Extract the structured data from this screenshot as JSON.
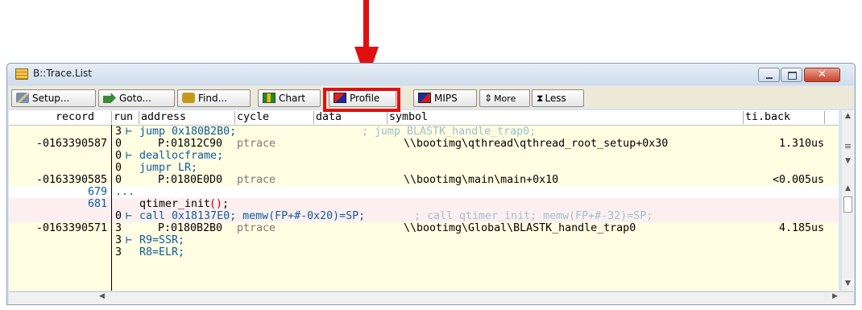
{
  "window": {
    "title": "B::Trace.List"
  },
  "toolbar": {
    "setup": "Setup...",
    "goto": "Goto...",
    "find": "Find...",
    "chart": "Chart",
    "profile": "Profile",
    "mips": "MIPS",
    "more": "More",
    "less": "Less"
  },
  "columns": {
    "record": "record",
    "run": "run",
    "address": "address",
    "cycle": "cycle",
    "data": "data",
    "symbol": "symbol",
    "tiback": "ti.back"
  },
  "rows": [
    {
      "bg": "y",
      "record": "",
      "run": "3",
      "text": "jump 0x180B2B0;",
      "comment": "; jump BLASTK_handle_trap0;"
    },
    {
      "bg": "y",
      "record": "-0163390587",
      "run": "0",
      "address": "P:01812C90",
      "cycle": "ptrace",
      "symbol": "\\\\bootimg\\qthread\\qthread_root_setup+0x30",
      "tiback": "1.310us"
    },
    {
      "bg": "y",
      "record": "",
      "run": "0",
      "text": "deallocframe;"
    },
    {
      "bg": "y",
      "record": "",
      "run": "0",
      "text": "jumpr LR;"
    },
    {
      "bg": "y",
      "record": "-0163390585",
      "run": "0",
      "address": "P:0180E0D0",
      "cycle": "ptrace",
      "symbol": "\\\\bootimg\\main\\main+0x10",
      "tiback": "<0.005us"
    },
    {
      "bg": "w",
      "record": "679",
      "run": "...",
      "text": ""
    },
    {
      "bg": "p",
      "record": "681",
      "run": "",
      "source": "qtimer_init",
      "paren": "()",
      "semi": ";"
    },
    {
      "bg": "p",
      "record": "",
      "run": "0",
      "text": "call 0x18137E0; memw(FP+#-0x20)=SP;",
      "comment": "; call qtimer_init; memw(FP+#-32)=SP;"
    },
    {
      "bg": "y",
      "record": "-0163390571",
      "run": "3",
      "address": "P:0180B2B0",
      "cycle": "ptrace",
      "symbol": "\\\\bootimg\\Global\\BLASTK_handle_trap0",
      "tiback": "4.185us"
    },
    {
      "bg": "y",
      "record": "",
      "run": "3",
      "text": "R9=SSR;"
    },
    {
      "bg": "y",
      "record": "",
      "run": "3",
      "text": "R8=ELR;"
    }
  ]
}
